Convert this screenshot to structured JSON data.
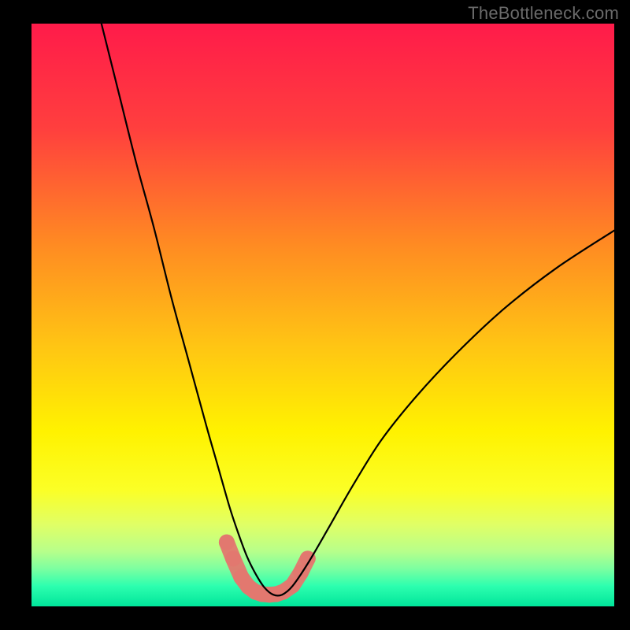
{
  "watermark": "TheBottleneck.com",
  "chart_data": {
    "type": "line",
    "title": "",
    "xlabel": "",
    "ylabel": "",
    "xlim": [
      0,
      100
    ],
    "ylim": [
      0,
      100
    ],
    "legend": false,
    "grid": false,
    "background_gradient": {
      "stops": [
        {
          "pos": 0.0,
          "color": "#ff1b4a"
        },
        {
          "pos": 0.18,
          "color": "#ff3f3e"
        },
        {
          "pos": 0.38,
          "color": "#ff8b22"
        },
        {
          "pos": 0.55,
          "color": "#ffc414"
        },
        {
          "pos": 0.7,
          "color": "#fff200"
        },
        {
          "pos": 0.8,
          "color": "#fbff26"
        },
        {
          "pos": 0.86,
          "color": "#e0ff66"
        },
        {
          "pos": 0.905,
          "color": "#b8ff8a"
        },
        {
          "pos": 0.935,
          "color": "#7dffa0"
        },
        {
          "pos": 0.965,
          "color": "#2dffaf"
        },
        {
          "pos": 1.0,
          "color": "#00e59a"
        }
      ]
    },
    "series": [
      {
        "name": "bottleneck-curve",
        "color": "#000000",
        "width": 2.2,
        "x": [
          12.0,
          15.0,
          18.0,
          21.0,
          24.0,
          27.0,
          30.0,
          32.0,
          34.0,
          35.5,
          37.0,
          38.5,
          40.0,
          41.5,
          43.0,
          44.8,
          47.5,
          51.0,
          55.0,
          60.0,
          66.0,
          73.0,
          81.0,
          90.0,
          100.0
        ],
        "y": [
          100.0,
          88.0,
          76.0,
          65.0,
          53.0,
          42.0,
          31.0,
          24.0,
          17.0,
          12.5,
          8.5,
          5.5,
          3.2,
          2.0,
          2.0,
          3.5,
          7.5,
          13.5,
          20.5,
          28.5,
          36.0,
          43.5,
          51.0,
          58.0,
          64.5
        ]
      },
      {
        "name": "marker-band",
        "type": "scatter",
        "color": "#e2786f",
        "radius_px": 10,
        "x": [
          33.5,
          34.6,
          36.0,
          37.2,
          38.4,
          39.6,
          40.8,
          42.0,
          43.2,
          44.8,
          46.2,
          47.4
        ],
        "y": [
          11.0,
          8.2,
          5.0,
          3.4,
          2.5,
          2.1,
          2.0,
          2.1,
          2.5,
          3.6,
          5.8,
          8.2
        ]
      }
    ],
    "annotations": []
  }
}
